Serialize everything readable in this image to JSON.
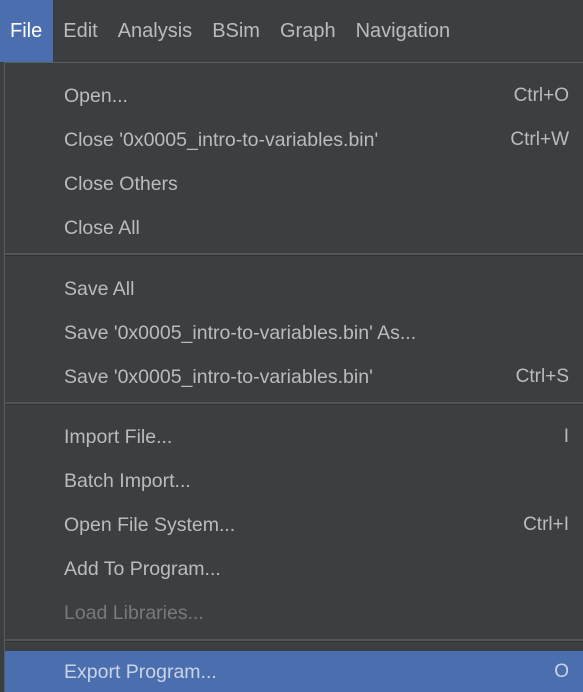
{
  "menubar": {
    "items": [
      {
        "label": "File"
      },
      {
        "label": "Edit"
      },
      {
        "label": "Analysis"
      },
      {
        "label": "BSim"
      },
      {
        "label": "Graph"
      },
      {
        "label": "Navigation"
      }
    ]
  },
  "file_menu": {
    "open": {
      "label": "Open...",
      "shortcut": "Ctrl+O"
    },
    "close": {
      "label": "Close '0x0005_intro-to-variables.bin'",
      "shortcut": "Ctrl+W"
    },
    "close_others": {
      "label": "Close Others"
    },
    "close_all": {
      "label": "Close All"
    },
    "save_all": {
      "label": "Save All"
    },
    "save_as": {
      "label": "Save '0x0005_intro-to-variables.bin' As..."
    },
    "save": {
      "label": "Save '0x0005_intro-to-variables.bin'",
      "shortcut": "Ctrl+S"
    },
    "import_file": {
      "label": "Import File...",
      "shortcut": "I"
    },
    "batch_import": {
      "label": "Batch Import..."
    },
    "open_file_system": {
      "label": "Open File System...",
      "shortcut": "Ctrl+I"
    },
    "add_to_program": {
      "label": "Add To Program..."
    },
    "load_libraries": {
      "label": "Load Libraries..."
    },
    "export_program": {
      "label": "Export Program...",
      "shortcut": "O"
    }
  },
  "colors": {
    "background": "#3c3f41",
    "text": "#bbbbbb",
    "disabled_text": "#777a7d",
    "selection": "#4b6eaf"
  }
}
